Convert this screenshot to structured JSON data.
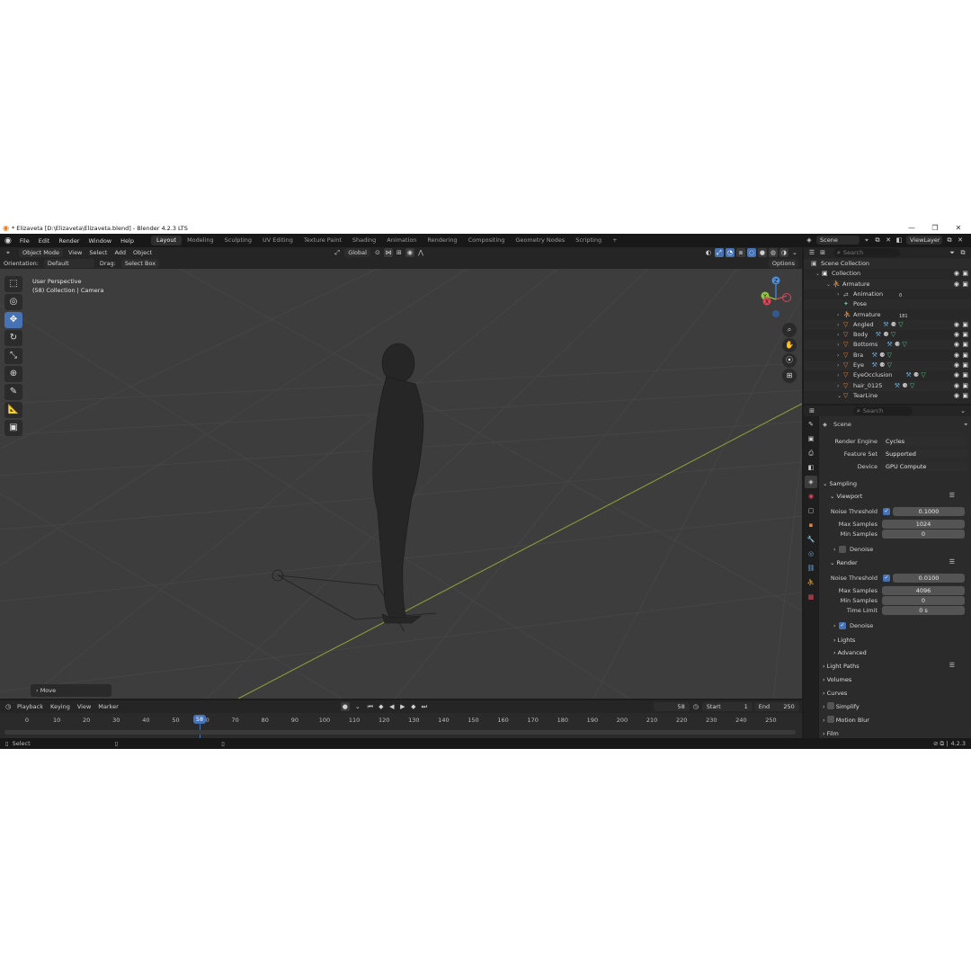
{
  "window": {
    "title": "* Elizaveta [D:\\Elizaveta\\Elizaveta.blend] - Blender 4.2.3 LTS",
    "controls": [
      "—",
      "❐",
      "✕"
    ]
  },
  "menu": {
    "items": [
      "File",
      "Edit",
      "Render",
      "Window",
      "Help"
    ],
    "workspaces": [
      "Layout",
      "Modeling",
      "Sculpting",
      "UV Editing",
      "Texture Paint",
      "Shading",
      "Animation",
      "Rendering",
      "Compositing",
      "Geometry Nodes",
      "Scripting"
    ],
    "active_workspace": "Layout",
    "add_tab": "+",
    "scene_label": "Scene",
    "viewlayer_label": "ViewLayer"
  },
  "viewport_header": {
    "mode": "Object Mode",
    "menus": [
      "View",
      "Select",
      "Add",
      "Object"
    ],
    "transform_orientation": "Global",
    "options": "Options"
  },
  "viewport_tool_settings": {
    "orientation_label": "Orientation:",
    "orientation_value": "Default",
    "drag_label": "Drag:",
    "drag_value": "Select Box"
  },
  "viewport": {
    "perspective": "User Perspective",
    "context": "(58) Collection | Camera",
    "last_operator": "Move",
    "gizmo_axes": [
      "X",
      "Y",
      "Z"
    ]
  },
  "timeline": {
    "menus": [
      "Playback",
      "Keying",
      "View",
      "Marker"
    ],
    "current_frame": "58",
    "start_label": "Start",
    "start_value": "1",
    "end_label": "End",
    "end_value": "250",
    "ticks": [
      "0",
      "10",
      "20",
      "30",
      "40",
      "50",
      "60",
      "70",
      "80",
      "90",
      "100",
      "110",
      "120",
      "130",
      "140",
      "150",
      "160",
      "170",
      "180",
      "190",
      "200",
      "210",
      "220",
      "230",
      "240",
      "250"
    ]
  },
  "statusbar": {
    "left": "Select",
    "version": "4.2.3"
  },
  "outliner": {
    "search_placeholder": "Search",
    "rows": [
      {
        "label": "Scene Collection",
        "indent": 0,
        "icon": "▣",
        "icon_color": "#bcbcbc",
        "tri": "",
        "vis": false
      },
      {
        "label": "Collection",
        "indent": 1,
        "icon": "▣",
        "icon_color": "#e6e6e6",
        "tri": "⌄",
        "vis": true
      },
      {
        "label": "Armature",
        "indent": 2,
        "icon": "⛹",
        "icon_color": "#e0894a",
        "tri": "⌄",
        "vis": true
      },
      {
        "label": "Animation",
        "indent": 3,
        "icon": "⥄",
        "icon_color": "#bcbcbc",
        "tri": "›",
        "vis": false,
        "extra": "0"
      },
      {
        "label": "Pose",
        "indent": 3,
        "icon": "✦",
        "icon_color": "#5fbf8f",
        "tri": "",
        "vis": false
      },
      {
        "label": "Armature",
        "indent": 3,
        "icon": "⛹",
        "icon_color": "#5fbf8f",
        "tri": "›",
        "vis": false,
        "extra": "181"
      },
      {
        "label": "Angled",
        "indent": 3,
        "icon": "▽",
        "icon_color": "#e0894a",
        "tri": "›",
        "vis": true,
        "mods": true
      },
      {
        "label": "Body",
        "indent": 3,
        "icon": "▽",
        "icon_color": "#e0894a",
        "tri": "›",
        "vis": true,
        "mods": true
      },
      {
        "label": "Bottoms",
        "indent": 3,
        "icon": "▽",
        "icon_color": "#e0894a",
        "tri": "›",
        "vis": true,
        "mods": true
      },
      {
        "label": "Bra",
        "indent": 3,
        "icon": "▽",
        "icon_color": "#e0894a",
        "tri": "›",
        "vis": true,
        "mods": true
      },
      {
        "label": "Eye",
        "indent": 3,
        "icon": "▽",
        "icon_color": "#e0894a",
        "tri": "›",
        "vis": true,
        "mods": true
      },
      {
        "label": "EyeOcclusion",
        "indent": 3,
        "icon": "▽",
        "icon_color": "#e0894a",
        "tri": "›",
        "vis": true,
        "mods": true
      },
      {
        "label": "hair_0125",
        "indent": 3,
        "icon": "▽",
        "icon_color": "#e0894a",
        "tri": "›",
        "vis": true,
        "mods": true
      },
      {
        "label": "TearLine",
        "indent": 3,
        "icon": "▽",
        "icon_color": "#e0894a",
        "tri": "⌄",
        "vis": true
      }
    ]
  },
  "properties": {
    "search_placeholder": "Search",
    "context": "Scene",
    "render_engine_label": "Render Engine",
    "render_engine": "Cycles",
    "feature_set_label": "Feature Set",
    "feature_set": "Supported",
    "device_label": "Device",
    "device": "GPU Compute",
    "sampling": "Sampling",
    "viewport_panel": "Viewport",
    "vp_noise_label": "Noise Threshold",
    "vp_noise": "0.1000",
    "vp_max_label": "Max Samples",
    "vp_max": "1024",
    "vp_min_label": "Min Samples",
    "vp_min": "0",
    "vp_denoise": "Denoise",
    "render_panel": "Render",
    "r_noise_label": "Noise Threshold",
    "r_noise": "0.0100",
    "r_max_label": "Max Samples",
    "r_max": "4096",
    "r_min_label": "Min Samples",
    "r_min": "0",
    "r_time_label": "Time Limit",
    "r_time": "0 s",
    "r_denoise": "Denoise",
    "lights": "Lights",
    "advanced": "Advanced",
    "light_paths": "Light Paths",
    "volumes": "Volumes",
    "curves": "Curves",
    "simplify": "Simplify",
    "motion_blur": "Motion Blur",
    "film": "Film"
  },
  "colors": {
    "accent": "#4772b3",
    "viewport_bg": "#3d3d3d",
    "x_axis": "#d9465b",
    "y_axis": "#8fc73e",
    "z_axis": "#4a8fe0"
  }
}
